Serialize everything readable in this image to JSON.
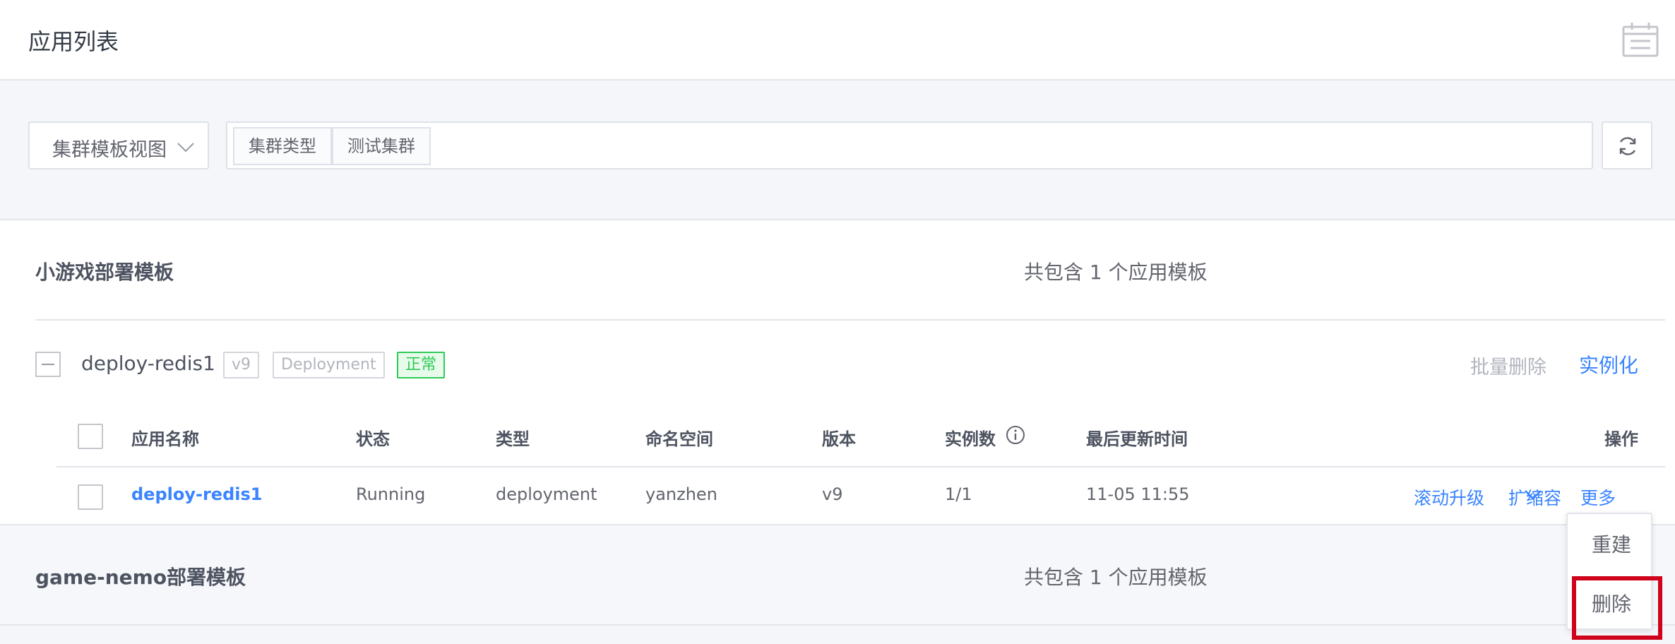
{
  "header": {
    "title": "应用列表",
    "calendar_icon": "calendar-icon"
  },
  "toolbar": {
    "view_select": "集群模板视图",
    "filter_tags": [
      "集群类型",
      "测试集群"
    ],
    "refresh_icon": "refresh-icon"
  },
  "template_groups": [
    {
      "title": "小游戏部署模板",
      "count_text": "共包含 1 个应用模板",
      "app": {
        "name": "deploy-redis1",
        "version_badge": "v9",
        "kind_badge": "Deployment",
        "status_badge": "正常",
        "batch_delete": "批量删除",
        "instantiate": "实例化"
      },
      "table": {
        "headers": [
          "应用名称",
          "状态",
          "类型",
          "命名空间",
          "版本",
          "实例数",
          "最后更新时间",
          "操作"
        ],
        "rows": [
          {
            "name": "deploy-redis1",
            "status": "Running",
            "type": "deployment",
            "namespace": "yanzhen",
            "version": "v9",
            "instances": "1/1",
            "updated": "11-05 11:55",
            "actions": [
              "滚动升级",
              "扩缩容",
              "更多"
            ]
          }
        ]
      }
    },
    {
      "title": "game-nemo部署模板",
      "count_text": "共包含 1 个应用模板"
    }
  ],
  "more_menu": {
    "items": [
      "重建",
      "删除"
    ]
  },
  "colors": {
    "accent": "#3a84ff",
    "success": "#2dcb56",
    "highlight": "#d0021b"
  }
}
